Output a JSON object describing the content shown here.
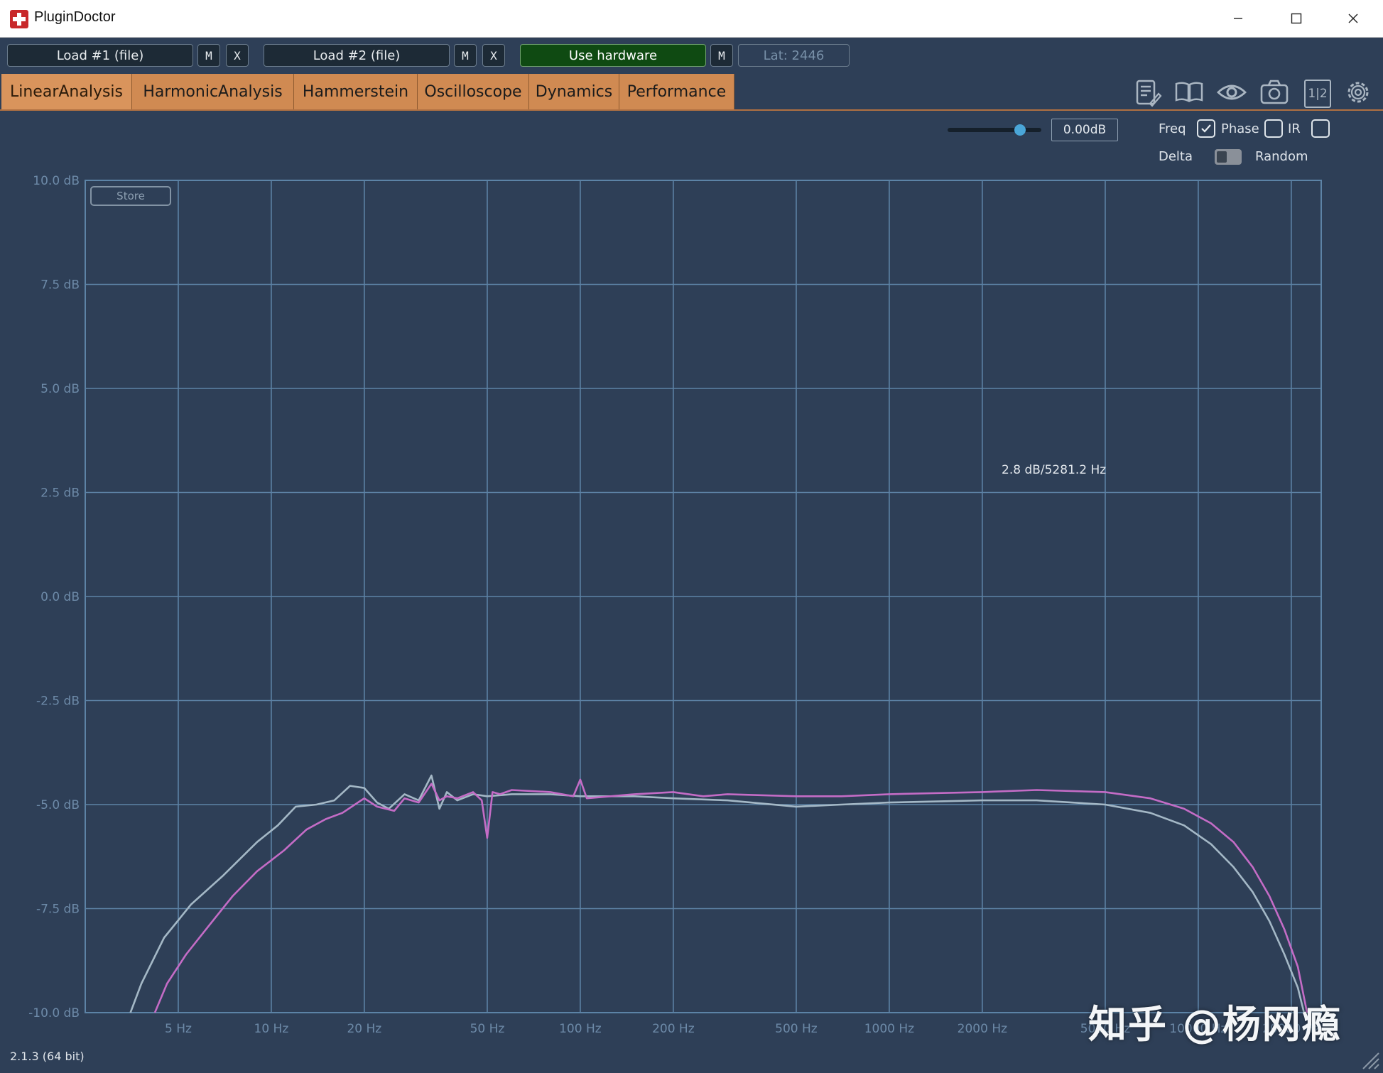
{
  "window": {
    "title": "PluginDoctor"
  },
  "toolbar": {
    "load1": "Load #1 (file)",
    "load2": "Load #2 (file)",
    "m": "M",
    "x": "X",
    "use_hardware": "Use hardware",
    "latency": "Lat: 2446"
  },
  "tabs": [
    "LinearAnalysis",
    "HarmonicAnalysis",
    "Hammerstein",
    "Oscilloscope",
    "Dynamics",
    "Performance"
  ],
  "active_tab": "LinearAnalysis",
  "tool_icons": [
    "notes-icon",
    "book-icon",
    "eye-icon",
    "camera-icon",
    "split-1-2-icon",
    "gear-icon"
  ],
  "split_icon_text": "1|2",
  "controls": {
    "gain_value": "0.00dB",
    "gain_slider_fraction": 0.77,
    "freq_label": "Freq",
    "phase_label": "Phase",
    "ir_label": "IR",
    "delta_label": "Delta",
    "random_label": "Random",
    "freq_checked": true,
    "phase_checked": false,
    "ir_checked": false,
    "delta_random_toggle": "Delta"
  },
  "plot": {
    "store_label": "Store",
    "cursor_readout": "2.8 dB/5281.2 Hz"
  },
  "version": "2.1.3 (64 bit)",
  "watermark": "知乎 @杨网瘾",
  "colors": {
    "background": "#2e3f57",
    "grid": "#5d83a6",
    "series1": "#c46cc6",
    "series2": "#a4b8c6",
    "tab": "#d08a52",
    "hardware": "#0f4a12"
  },
  "chart_data": {
    "type": "line",
    "title": "",
    "xlabel": "",
    "ylabel": "",
    "x_scale": "log",
    "xlim": [
      2.5,
      25000
    ],
    "ylim": [
      -10,
      10
    ],
    "grid": true,
    "x_ticks": [
      5,
      10,
      20,
      50,
      100,
      200,
      500,
      1000,
      2000,
      5000,
      10000,
      20000
    ],
    "x_tick_labels": [
      "5 Hz",
      "10 Hz",
      "20 Hz",
      "50 Hz",
      "100 Hz",
      "200 Hz",
      "500 Hz",
      "1000 Hz",
      "2000 Hz",
      "5000 Hz",
      "10000 Hz",
      "20000 Hz"
    ],
    "y_ticks": [
      10,
      7.5,
      5,
      2.5,
      0,
      -2.5,
      -5,
      -7.5,
      -10
    ],
    "y_tick_labels": [
      "10.0 dB",
      "7.5 dB",
      "5.0 dB",
      "2.5 dB",
      "0.0 dB",
      "-2.5 dB",
      "-5.0 dB",
      "-7.5 dB",
      "-10.0 dB"
    ],
    "series": [
      {
        "color": "#a4b8c6",
        "x": [
          3.5,
          3.8,
          4.5,
          5.5,
          7,
          9,
          10.5,
          12,
          14,
          16,
          18,
          20,
          22,
          24,
          27,
          30,
          33,
          35,
          37,
          40,
          45,
          50,
          60,
          80,
          100,
          150,
          200,
          300,
          500,
          700,
          1000,
          2000,
          3000,
          5000,
          7000,
          9000,
          11000,
          13000,
          15000,
          17000,
          19000,
          21000,
          22000
        ],
        "y": [
          -10,
          -9.3,
          -8.2,
          -7.4,
          -6.7,
          -5.9,
          -5.5,
          -5.05,
          -5.0,
          -4.9,
          -4.55,
          -4.6,
          -4.95,
          -5.1,
          -4.75,
          -4.9,
          -4.3,
          -5.1,
          -4.7,
          -4.9,
          -4.75,
          -4.8,
          -4.75,
          -4.75,
          -4.8,
          -4.8,
          -4.85,
          -4.9,
          -5.05,
          -5.0,
          -4.95,
          -4.9,
          -4.9,
          -5.0,
          -5.2,
          -5.5,
          -5.95,
          -6.5,
          -7.1,
          -7.8,
          -8.6,
          -9.4,
          -10
        ]
      },
      {
        "color": "#c46cc6",
        "x": [
          4.2,
          4.6,
          5.3,
          6.3,
          7.5,
          9,
          11,
          13,
          15,
          17,
          20,
          22,
          25,
          27,
          30,
          33,
          35,
          37,
          40,
          45,
          48,
          50,
          52,
          55,
          60,
          80,
          95,
          100,
          105,
          150,
          200,
          250,
          300,
          500,
          700,
          1000,
          2000,
          3000,
          5000,
          7000,
          9000,
          11000,
          13000,
          15000,
          17000,
          19000,
          21000,
          22500
        ],
        "y": [
          -10,
          -9.3,
          -8.6,
          -7.9,
          -7.2,
          -6.6,
          -6.1,
          -5.6,
          -5.35,
          -5.2,
          -4.85,
          -5.05,
          -5.15,
          -4.85,
          -4.95,
          -4.5,
          -4.9,
          -4.8,
          -4.85,
          -4.7,
          -4.9,
          -5.8,
          -4.7,
          -4.75,
          -4.65,
          -4.7,
          -4.8,
          -4.4,
          -4.85,
          -4.75,
          -4.7,
          -4.8,
          -4.75,
          -4.8,
          -4.8,
          -4.75,
          -4.7,
          -4.65,
          -4.7,
          -4.85,
          -5.1,
          -5.45,
          -5.9,
          -6.5,
          -7.2,
          -8.0,
          -8.9,
          -10
        ]
      }
    ]
  }
}
